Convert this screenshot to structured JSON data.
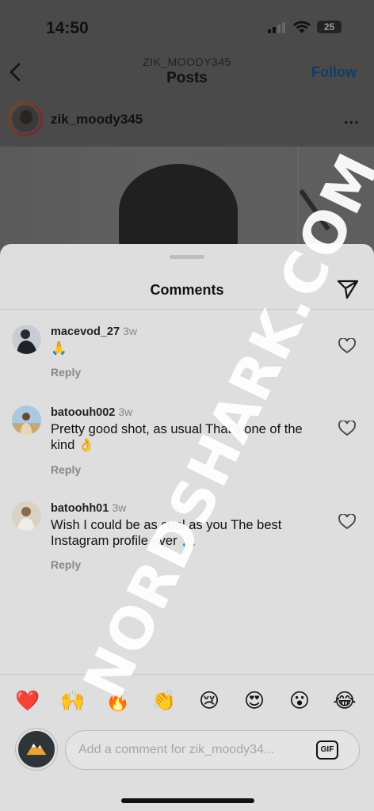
{
  "status_bar": {
    "time": "14:50",
    "battery": "25"
  },
  "header": {
    "username": "ZIK_MOODY345",
    "title": "Posts",
    "follow_label": "Follow"
  },
  "post": {
    "username": "zik_moody345",
    "more_label": "..."
  },
  "sheet": {
    "title": "Comments"
  },
  "comments": [
    {
      "username": "macevod_27",
      "time": "3w",
      "text": "🙏",
      "reply_label": "Reply"
    },
    {
      "username": "batoouh002",
      "time": "3w",
      "text": "Pretty good shot, as usual That’s one of the kind 👌",
      "reply_label": "Reply"
    },
    {
      "username": "batoohh01",
      "time": "3w",
      "text": "Wish I could be as cool as you The best Instagram profile ever 🙏",
      "reply_label": "Reply"
    }
  ],
  "reactions": [
    "❤️",
    "🙌",
    "🔥",
    "👏",
    "😢",
    "😍",
    "😮",
    "😂"
  ],
  "composer": {
    "placeholder": "Add a comment for zik_moody34...",
    "gif_label": "GIF"
  },
  "watermark": "NORDSHARK.COM",
  "colors": {
    "sheet_bg": "#dedede",
    "dim_bg": "#4d4d4d",
    "follow": "#123d66"
  }
}
